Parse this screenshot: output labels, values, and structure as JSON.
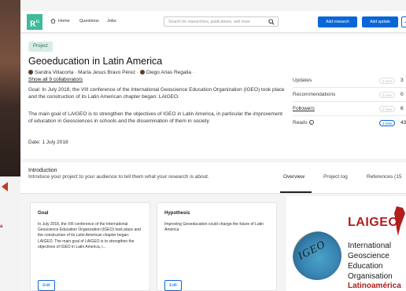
{
  "topbar": {
    "logo_text": "R",
    "logo_sup": "G",
    "nav": [
      "Home",
      "Questions",
      "Jobs"
    ],
    "search_placeholder": "Search for researchers, publications, and more",
    "add_research_label": "Add research",
    "add_update_label": "Add update"
  },
  "project": {
    "tag": "Project",
    "title": "Geoeducation in Latin America",
    "authors": [
      "Sandra Villacorta",
      "María Jesus Bravo Pérez",
      "Diego Arias Regalia"
    ],
    "show_all": "Show all 9 collaborators",
    "goal": "Goal: In July 2018, the VIII conference of the International Geoscience Education Organization (IGEO) took place and the construction of its Latin American chapter began: LAIGEO.",
    "main_goal": "The main goal of LAIGEO is to strengthen the objectives of IGEO in Latin America, in particular the improvement of education in Geosciences in schools and the dissemination of them in society.",
    "date": "Date: 1 July 2018"
  },
  "stats": [
    {
      "label": "Updates",
      "pill": "0 new",
      "value": "3"
    },
    {
      "label": "Recommendations",
      "pill": "0 new",
      "value": "0"
    },
    {
      "label": "Followers",
      "pill": "0 new",
      "value": "6"
    },
    {
      "label": "Reads",
      "pill": "3 new",
      "value": "43"
    }
  ],
  "intro": {
    "heading": "Introduction",
    "text": "Introduce your project to your audience to tell them what your research is about.",
    "tabs": [
      "Overview",
      "Project log",
      "References (15"
    ]
  },
  "cards": {
    "goal": {
      "heading": "Goal",
      "text": "In July 2018, the VIII conference of the International Geoscience Education Organization (IGEO) took place and the construction of its Latin American chapter began: LAIGEO. The main goal of LAIGEO is to strengthen the objectives of IGEO in Latin America, i...",
      "edit": "Edit"
    },
    "hypothesis": {
      "heading": "Hypothesis",
      "text": "Improving Geoeducation could change the future of Latin America",
      "edit": "Edit"
    }
  },
  "logo": {
    "igeo": "IGEO",
    "laigeo": "LAIGEO",
    "lines": [
      "International",
      "Geoscience",
      "Education",
      "Organisation"
    ],
    "red_line": "Latinoamérica"
  },
  "left_strip_text": "a",
  "colors": {
    "brand": "#40ba9b",
    "primary": "#0a66d8",
    "accent_red": "#b21e1e"
  }
}
